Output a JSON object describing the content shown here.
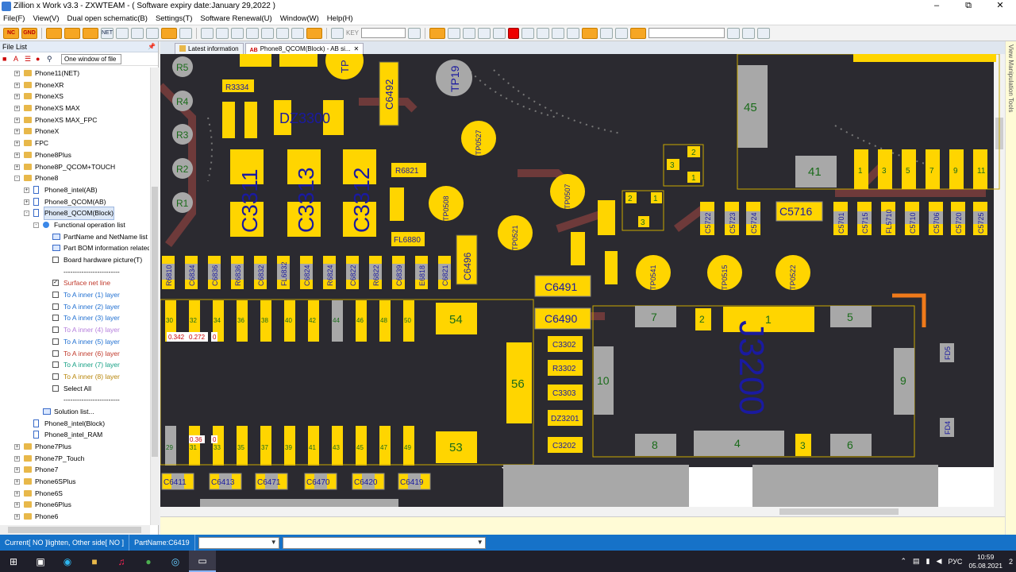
{
  "window": {
    "title": "Zillion x Work v3.3 - ZXWTEAM - ( Software expiry date:January 29,2022 )",
    "controls": [
      "–",
      "⧉",
      "✕"
    ]
  },
  "menu": [
    "File(F)",
    "View(V)",
    "Dual open schematic(B)",
    "Settings(T)",
    "Software Renewal(U)",
    "Window(W)",
    "Help(H)"
  ],
  "toolbar": {
    "btn_nc": "NC",
    "btn_gnd": "GND",
    "btn_net": "NET",
    "key_label": "KEY",
    "accent_red": "#e00000"
  },
  "sidebar": {
    "title": "File List",
    "scope_select": "One window of file",
    "tree": [
      {
        "label": "Phone11(NET)",
        "icon": "folder",
        "depth": 1,
        "exp": "+"
      },
      {
        "label": "PhoneXR",
        "icon": "folder",
        "depth": 1,
        "exp": "+"
      },
      {
        "label": "PhoneXS",
        "icon": "folder",
        "depth": 1,
        "exp": "+"
      },
      {
        "label": "PhoneXS MAX",
        "icon": "folder",
        "depth": 1,
        "exp": "+"
      },
      {
        "label": "PhoneXS MAX_FPC",
        "icon": "folder",
        "depth": 1,
        "exp": "+"
      },
      {
        "label": "PhoneX",
        "icon": "folder",
        "depth": 1,
        "exp": "+"
      },
      {
        "label": "FPC",
        "icon": "folder",
        "depth": 1,
        "exp": "+"
      },
      {
        "label": "Phone8Plus",
        "icon": "folder",
        "depth": 1,
        "exp": "+"
      },
      {
        "label": "Phone8P_QCOM+TOUCH",
        "icon": "folder",
        "depth": 1,
        "exp": "+"
      },
      {
        "label": "Phone8",
        "icon": "folder",
        "depth": 1,
        "exp": "-"
      },
      {
        "label": "Phone8_intel(AB)",
        "icon": "doc",
        "depth": 2,
        "exp": "+"
      },
      {
        "label": "Phone8_QCOM(AB)",
        "icon": "doc",
        "depth": 2,
        "exp": "+"
      },
      {
        "label": "Phone8_QCOM(Block)",
        "icon": "doc",
        "depth": 2,
        "exp": "-",
        "selected": true
      },
      {
        "label": "Functional operation list",
        "icon": "gear",
        "depth": 3,
        "exp": "-"
      },
      {
        "label": "PartName and NetName list",
        "icon": "list",
        "depth": 4
      },
      {
        "label": "Part BOM information related ...",
        "icon": "list",
        "depth": 4
      },
      {
        "label": "Board hardware picture(T)",
        "icon": "check",
        "depth": 4
      },
      {
        "label": "-------------------------",
        "icon": "none",
        "depth": 4
      },
      {
        "label": "Surface net line",
        "icon": "check-on",
        "depth": 4,
        "color": "#c0392b"
      },
      {
        "label": "To A inner (1) layer",
        "icon": "check",
        "depth": 4,
        "color": "#1f6fd1"
      },
      {
        "label": "To A inner (2) layer",
        "icon": "check",
        "depth": 4,
        "color": "#1f6fd1"
      },
      {
        "label": "To A inner (3) layer",
        "icon": "check",
        "depth": 4,
        "color": "#1f6fd1"
      },
      {
        "label": "To A inner (4) layer",
        "icon": "check",
        "depth": 4,
        "color": "#b57edc"
      },
      {
        "label": "To A inner (5) layer",
        "icon": "check",
        "depth": 4,
        "color": "#1f6fd1"
      },
      {
        "label": "To A inner (6) layer",
        "icon": "check",
        "depth": 4,
        "color": "#c0392b"
      },
      {
        "label": "To A inner (7) layer",
        "icon": "check",
        "depth": 4,
        "color": "#16a085"
      },
      {
        "label": "To A inner (8) layer",
        "icon": "check",
        "depth": 4,
        "color": "#b8860b"
      },
      {
        "label": "Select All",
        "icon": "check",
        "depth": 4
      },
      {
        "label": "-------------------------",
        "icon": "none",
        "depth": 4
      },
      {
        "label": "Solution list...",
        "icon": "list",
        "depth": 3
      },
      {
        "label": "Phone8_intel(Block)",
        "icon": "doc",
        "depth": 2
      },
      {
        "label": "Phone8_intel_RAM",
        "icon": "doc",
        "depth": 2
      },
      {
        "label": "Phone7Plus",
        "icon": "folder",
        "depth": 1,
        "exp": "+"
      },
      {
        "label": "Phone7P_Touch",
        "icon": "folder",
        "depth": 1,
        "exp": "+"
      },
      {
        "label": "Phone7",
        "icon": "folder",
        "depth": 1,
        "exp": "+"
      },
      {
        "label": "Phone6SPlus",
        "icon": "folder",
        "depth": 1,
        "exp": "+"
      },
      {
        "label": "Phone6S",
        "icon": "folder",
        "depth": 1,
        "exp": "+"
      },
      {
        "label": "Phone6Plus",
        "icon": "folder",
        "depth": 1,
        "exp": "+"
      },
      {
        "label": "Phone6",
        "icon": "folder",
        "depth": 1,
        "exp": "+"
      }
    ]
  },
  "tabs": [
    {
      "label": "Latest information",
      "active": false
    },
    {
      "label": "Phone8_QCOM(Block) - AB si...",
      "active": true,
      "prefix": "AB"
    }
  ],
  "right_panel": {
    "label": "View Manipulation Tools"
  },
  "board": {
    "colors": {
      "pcb": "#2b2a30",
      "pad": "#ffd500",
      "gray": "#a8a8a8",
      "trace": "#6e3a3a",
      "label": "#1a1aa0",
      "num": "#1a6b1a"
    },
    "labels": {
      "dz3300": "DZ3300",
      "c3311": "C3311",
      "c3313": "C3313",
      "c3312": "C3312",
      "tp19": "TP19",
      "c6492": "C6492",
      "c6491": "C6491",
      "c6490": "C6490",
      "c6496": "C6496",
      "j3200": "J3200",
      "c5716": "C5716",
      "tp0527": "TP0527",
      "tp0508": "TP0508",
      "tp0507": "TP0507",
      "tp0521": "TP0521",
      "tp0541": "TP0541",
      "tp0515": "TP0515",
      "tp0522": "TP0522",
      "r5": "R5",
      "r4": "R4",
      "r3": "R3",
      "r2": "R2",
      "r1": "R1",
      "n45": "45",
      "n41": "41",
      "n54": "54",
      "n56": "56",
      "n53": "53",
      "n7": "7",
      "n5": "5",
      "n1": "1",
      "n2": "2",
      "n3": "3",
      "n4": "4",
      "n6": "6",
      "n8": "8",
      "n9": "9",
      "n10": "10",
      "fd5": "FD5",
      "fd4": "FD4",
      "fl6880": "FL6880",
      "r6821": "R6821",
      "r3334": "R3334",
      "tp": "TP",
      "c3302": "C3302",
      "r3302": "R3302",
      "c3303": "C3303",
      "dz3201": "DZ3201",
      "c3202": "C3202",
      "c6411": "C6411",
      "c6413": "C6413",
      "c6471": "C6471",
      "c6470": "C6470",
      "c6420": "C6420",
      "c6419": "C6419",
      "v0342": "0.342",
      "v0272": "0.272",
      "v0": "0",
      "v036": "0.36",
      "v0b": "0"
    },
    "pad_row_top": [
      "30",
      "32",
      "34",
      "36",
      "38",
      "40",
      "42",
      "44",
      "46",
      "48",
      "50"
    ],
    "pad_row_bottom": [
      "29",
      "31",
      "33",
      "35",
      "37",
      "39",
      "41",
      "43",
      "45",
      "47",
      "49"
    ],
    "conn_pins_top": [
      "1",
      "3",
      "5",
      "7",
      "9",
      "11"
    ],
    "small_parts_row": [
      "R6810",
      "C6834",
      "C6836",
      "R6836",
      "C6832",
      "FL6832",
      "C6824",
      "R6824",
      "C6822",
      "R6822",
      "C6839",
      "E6818",
      "C6821"
    ],
    "right_parts_row": [
      "C5722",
      "C5723",
      "C5724",
      "C5701",
      "C5715",
      "FL5710",
      "C5710",
      "C5706",
      "C5720",
      "C5725"
    ]
  },
  "status": {
    "current": "Current[ NO ]lighten, Other side[ NO ]",
    "partname": "PartName:C6419"
  },
  "taskbar": {
    "lang": "РУС",
    "time": "10:59",
    "date": "05.08.2021",
    "notif": "2"
  }
}
